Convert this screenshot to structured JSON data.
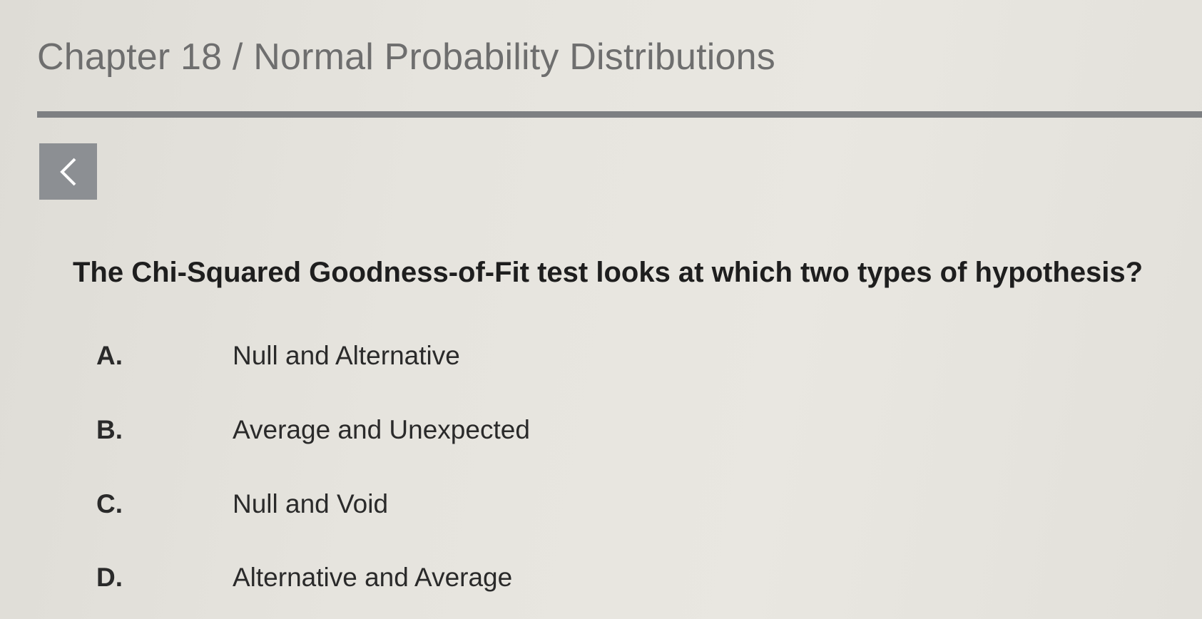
{
  "header": {
    "breadcrumb": "Chapter 18 / Normal Probability Distributions"
  },
  "navigation": {
    "back_icon": "chevron-left-icon"
  },
  "question": {
    "text": "The Chi-Squared Goodness-of-Fit test looks at which two types of hypothesis?",
    "options": [
      {
        "letter": "A.",
        "text": "Null and Alternative"
      },
      {
        "letter": "B.",
        "text": "Average and Unexpected"
      },
      {
        "letter": "C.",
        "text": "Null and Void"
      },
      {
        "letter": "D.",
        "text": "Alternative and Average"
      }
    ]
  },
  "colors": {
    "background": "#e6e4de",
    "divider": "#7d7f82",
    "back_button": "#8c8f93",
    "title_text": "#6e6e6e",
    "question_text": "#1e1e1e"
  }
}
